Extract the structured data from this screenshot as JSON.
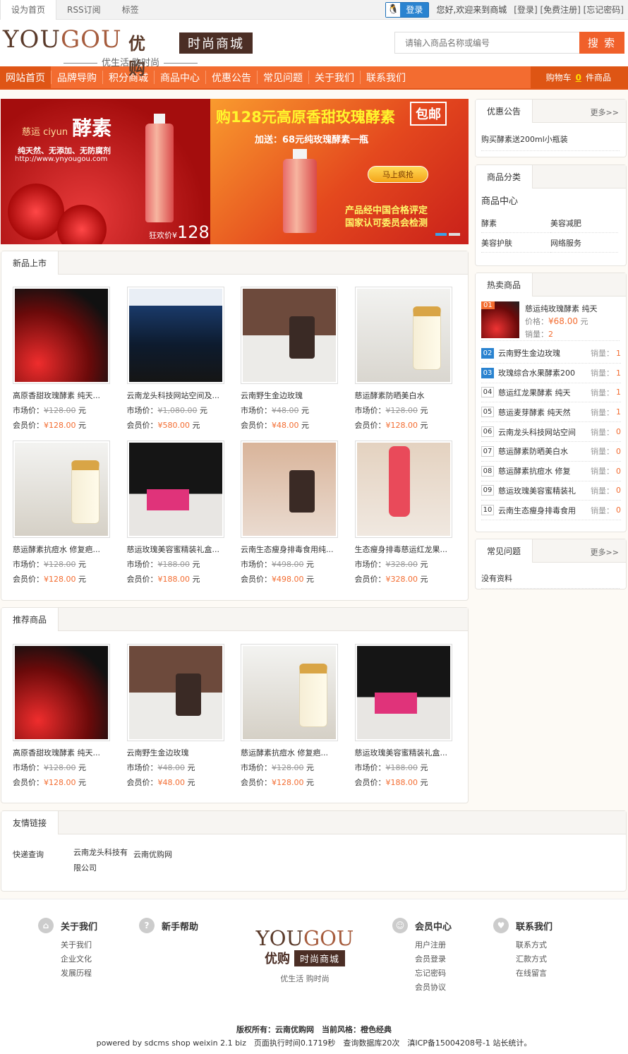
{
  "topbar": {
    "tabs": [
      "设为首页",
      "RSS订阅",
      "标签"
    ],
    "login_label": "登录",
    "greeting": "您好,欢迎来到商城",
    "links": "[登录] [免费注册] [忘记密码]"
  },
  "logo": {
    "en_a": "YOU",
    "en_b": "GOU",
    "cn": "优购",
    "shop": "时尚商城",
    "slogan": "优生活 购时尚"
  },
  "search": {
    "placeholder": "请输入商品名称或编号",
    "button": "搜 索"
  },
  "nav": {
    "items": [
      "网站首页",
      "品牌导购",
      "积分商城",
      "商品中心",
      "优惠公告",
      "常见问题",
      "关于我们",
      "联系我们"
    ],
    "cart_prefix": "购物车",
    "cart_count": "0",
    "cart_suffix": "件商品"
  },
  "banner": {
    "brand_cn": "慈运",
    "brand_en": "ciyun",
    "brand_title": "酵素",
    "features": "纯天然、无添加、无防腐剂",
    "url": "http://www.ynyougou.com",
    "price_label": "狂欢价¥",
    "price": "128",
    "title": "购128元高原香甜玫瑰酵素",
    "post": "包邮",
    "subtitle": "加送：68元纯玫瑰酵素一瓶",
    "button": "马上疯抢",
    "cert_line1": "产品经中国合格评定",
    "cert_line2": "国家认可委员会检测"
  },
  "labels": {
    "market": "市场价：",
    "member": "会员价：",
    "unit": "元",
    "sales": "销量：",
    "price": "价格：",
    "more": "更多>>"
  },
  "new_products": {
    "title": "新品上市",
    "items": [
      {
        "name": "高原香甜玫瑰酵素 纯天...",
        "market": "¥128.00",
        "member": "¥128.00"
      },
      {
        "name": "云南龙头科技网站空间及...",
        "market": "¥1,080.00",
        "member": "¥580.00"
      },
      {
        "name": "云南野生金边玫瑰",
        "market": "¥48.00",
        "member": "¥48.00"
      },
      {
        "name": "慈运酵素防晒美白水",
        "market": "¥128.00",
        "member": "¥128.00"
      },
      {
        "name": "慈运酵素抗痘水 修复疤...",
        "market": "¥128.00",
        "member": "¥128.00"
      },
      {
        "name": "慈运玫瑰美容蜜精装礼盒...",
        "market": "¥188.00",
        "member": "¥188.00"
      },
      {
        "name": "云南生态瘦身排毒食用纯...",
        "market": "¥498.00",
        "member": "¥498.00"
      },
      {
        "name": "生态瘦身排毒慈运红龙果...",
        "market": "¥328.00",
        "member": "¥328.00"
      }
    ]
  },
  "recommend": {
    "title": "推荐商品",
    "items": [
      {
        "name": "高原香甜玫瑰酵素 纯天...",
        "market": "¥128.00",
        "member": "¥128.00"
      },
      {
        "name": "云南野生金边玫瑰",
        "market": "¥48.00",
        "member": "¥48.00"
      },
      {
        "name": "慈运酵素抗痘水 修复疤...",
        "market": "¥128.00",
        "member": "¥128.00"
      },
      {
        "name": "慈运玫瑰美容蜜精装礼盒...",
        "market": "¥188.00",
        "member": "¥188.00"
      }
    ]
  },
  "links_panel": {
    "title": "友情链接",
    "items": [
      "快递查询",
      "云南龙头科技有限公司",
      "云南优购网"
    ]
  },
  "notice": {
    "title": "优惠公告",
    "item": "购买酵素送200ml小瓶装"
  },
  "category": {
    "title": "商品分类",
    "heading": "商品中心",
    "items": [
      "酵素",
      "美容减肥",
      "美容护肤",
      "网络服务"
    ]
  },
  "hot": {
    "title": "热卖商品",
    "first": {
      "num": "01",
      "name": "慈运纯玫瑰酵素 纯天",
      "price": "¥68.00",
      "sales": "2"
    },
    "items": [
      {
        "num": "02",
        "name": "云南野生金边玫瑰",
        "sales": "1"
      },
      {
        "num": "03",
        "name": "玫瑰综合水果酵素200",
        "sales": "1"
      },
      {
        "num": "04",
        "name": "慈运红龙果酵素 纯天",
        "sales": "1"
      },
      {
        "num": "05",
        "name": "慈运麦芽酵素 纯天然",
        "sales": "1"
      },
      {
        "num": "06",
        "name": "云南龙头科技网站空间",
        "sales": "0"
      },
      {
        "num": "07",
        "name": "慈运酵素防晒美白水",
        "sales": "0"
      },
      {
        "num": "08",
        "name": "慈运酵素抗痘水 修复",
        "sales": "0"
      },
      {
        "num": "09",
        "name": "慈运玫瑰美容蜜精装礼",
        "sales": "0"
      },
      {
        "num": "10",
        "name": "云南生态瘦身排毒食用",
        "sales": "0"
      }
    ]
  },
  "faq": {
    "title": "常见问题",
    "empty": "没有资料"
  },
  "footer": {
    "about": {
      "title": "关于我们",
      "items": [
        "关于我们",
        "企业文化",
        "发展历程"
      ]
    },
    "help": {
      "title": "新手帮助"
    },
    "member": {
      "title": "会员中心",
      "items": [
        "用户注册",
        "会员登录",
        "忘记密码",
        "会员协议"
      ]
    },
    "contact": {
      "title": "联系我们",
      "items": [
        "联系方式",
        "汇款方式",
        "在线留言"
      ]
    },
    "copyright": "版权所有：云南优购网　当前风格：橙色经典",
    "powered": "powered by sdcms shop weixin 2.1 biz　页面执行时间0.1719秒　查询数据库20次　滇ICP备15004208号-1 站长统计。"
  }
}
